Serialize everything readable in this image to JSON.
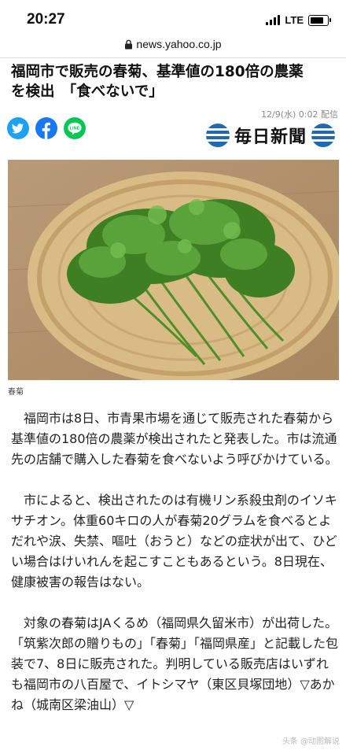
{
  "status_bar": {
    "time": "20:27",
    "network": "LTE",
    "battery_level": 0.9
  },
  "browser": {
    "url": "news.yahoo.co.jp"
  },
  "article": {
    "title": "福岡市で販売の春菊、基準値の180倍の農薬\nを検出　「食べないで」",
    "date": "12/9(水) 0:02 配信",
    "publisher": "毎日新聞",
    "share": {
      "twitter": "twitter-icon",
      "facebook": "facebook-icon",
      "line": "line-icon",
      "line_text": "LINE"
    },
    "photo_caption": "春菊",
    "paragraphs": [
      "福岡市は8日、市青果市場を通じて販売された春菊から基準値の180倍の農薬が検出されたと発表した。市は流通先の店舗で購入した春菊を食べないよう呼びかけている。",
      "市によると、検出されたのは有機リン系殺虫剤のイソキサチオン。体重60キロの人が春菊20グラムを食べるとよだれや涙、失禁、嘔吐（おうと）などの症状が出て、ひどい場合はけいれんを起こすこともあるという。8日現在、健康被害の報告はない。",
      "対象の春菊はJAくるめ（福岡県久留米市）が出荷した。「筑紫次郎の贈りもの」「春菊」「福岡県産」と記載した包装で7、8日に販売された。判明している販売店はいずれも福岡市の八百屋で、イトシマヤ（東区貝塚団地）▽あかね（城南区梁油山）▽"
    ]
  },
  "watermark": "头条 @动图解说",
  "colors": {
    "twitter": "#1da1f2",
    "facebook": "#1877f2",
    "line": "#06c755",
    "mainichi_blue": "#1e6ab0"
  }
}
